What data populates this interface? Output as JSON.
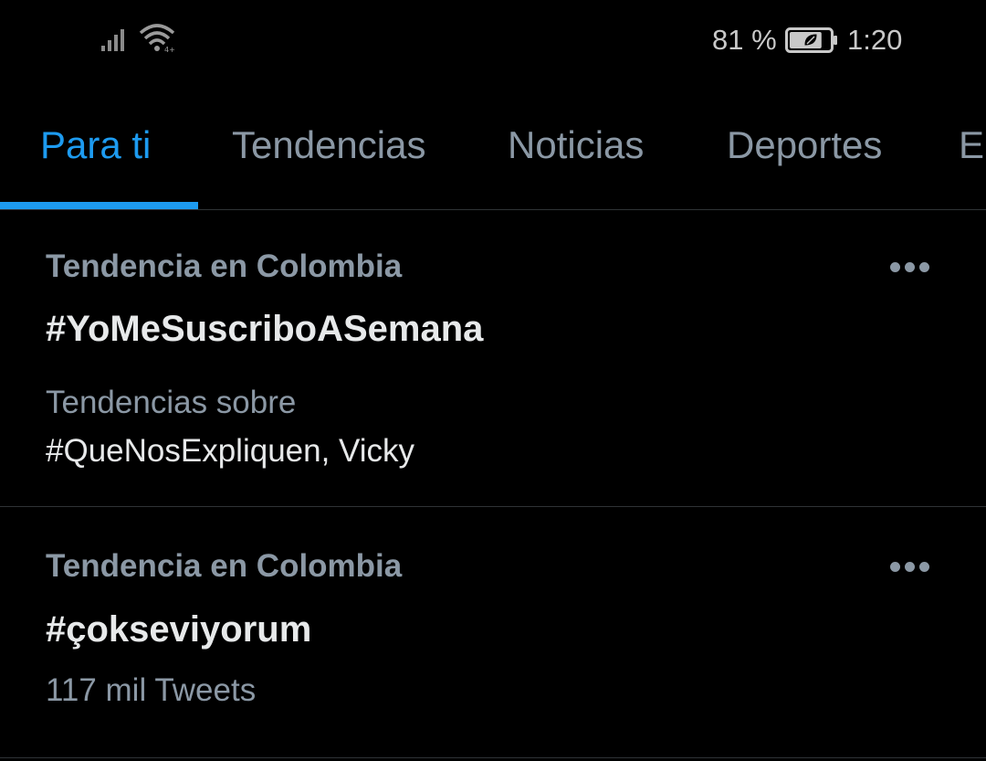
{
  "status_bar": {
    "battery_percent": "81 %",
    "battery_level": 0.81,
    "time": "1:20",
    "icons": [
      "signal-icon",
      "wifi-icon",
      "battery-saver-icon"
    ]
  },
  "tabs": [
    {
      "label": "Para ti",
      "active": true
    },
    {
      "label": "Tendencias",
      "active": false
    },
    {
      "label": "Noticias",
      "active": false
    },
    {
      "label": "Deportes",
      "active": false
    },
    {
      "label": "En",
      "active": false
    }
  ],
  "colors": {
    "accent": "#1d9bf0",
    "background": "#000000",
    "secondary_text": "#8b98a5",
    "primary_text": "#e7e9ea",
    "divider": "#2f3336"
  },
  "trends": [
    {
      "context": "Tendencia en Colombia",
      "name": "#YoMeSuscriboASemana",
      "related_label": "Tendencias sobre",
      "related_value": "#QueNosExpliquen, Vicky"
    },
    {
      "context": "Tendencia en Colombia",
      "name": "#çokseviyorum",
      "count": "117 mil Tweets"
    }
  ]
}
